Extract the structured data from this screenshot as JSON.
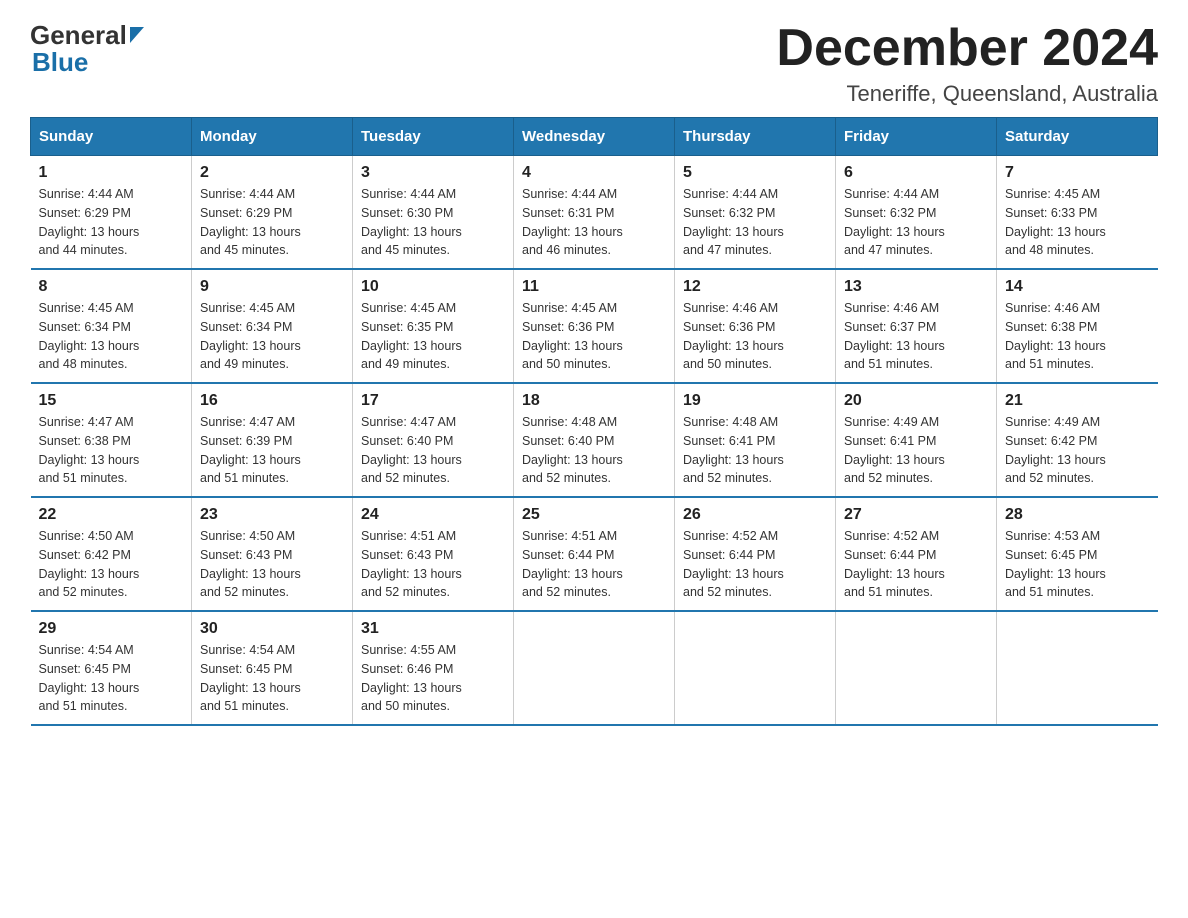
{
  "header": {
    "logo_general": "General",
    "logo_blue": "Blue",
    "month_title": "December 2024",
    "location": "Teneriffe, Queensland, Australia"
  },
  "weekdays": [
    "Sunday",
    "Monday",
    "Tuesday",
    "Wednesday",
    "Thursday",
    "Friday",
    "Saturday"
  ],
  "weeks": [
    [
      {
        "day": "1",
        "sunrise": "4:44 AM",
        "sunset": "6:29 PM",
        "daylight": "13 hours and 44 minutes."
      },
      {
        "day": "2",
        "sunrise": "4:44 AM",
        "sunset": "6:29 PM",
        "daylight": "13 hours and 45 minutes."
      },
      {
        "day": "3",
        "sunrise": "4:44 AM",
        "sunset": "6:30 PM",
        "daylight": "13 hours and 45 minutes."
      },
      {
        "day": "4",
        "sunrise": "4:44 AM",
        "sunset": "6:31 PM",
        "daylight": "13 hours and 46 minutes."
      },
      {
        "day": "5",
        "sunrise": "4:44 AM",
        "sunset": "6:32 PM",
        "daylight": "13 hours and 47 minutes."
      },
      {
        "day": "6",
        "sunrise": "4:44 AM",
        "sunset": "6:32 PM",
        "daylight": "13 hours and 47 minutes."
      },
      {
        "day": "7",
        "sunrise": "4:45 AM",
        "sunset": "6:33 PM",
        "daylight": "13 hours and 48 minutes."
      }
    ],
    [
      {
        "day": "8",
        "sunrise": "4:45 AM",
        "sunset": "6:34 PM",
        "daylight": "13 hours and 48 minutes."
      },
      {
        "day": "9",
        "sunrise": "4:45 AM",
        "sunset": "6:34 PM",
        "daylight": "13 hours and 49 minutes."
      },
      {
        "day": "10",
        "sunrise": "4:45 AM",
        "sunset": "6:35 PM",
        "daylight": "13 hours and 49 minutes."
      },
      {
        "day": "11",
        "sunrise": "4:45 AM",
        "sunset": "6:36 PM",
        "daylight": "13 hours and 50 minutes."
      },
      {
        "day": "12",
        "sunrise": "4:46 AM",
        "sunset": "6:36 PM",
        "daylight": "13 hours and 50 minutes."
      },
      {
        "day": "13",
        "sunrise": "4:46 AM",
        "sunset": "6:37 PM",
        "daylight": "13 hours and 51 minutes."
      },
      {
        "day": "14",
        "sunrise": "4:46 AM",
        "sunset": "6:38 PM",
        "daylight": "13 hours and 51 minutes."
      }
    ],
    [
      {
        "day": "15",
        "sunrise": "4:47 AM",
        "sunset": "6:38 PM",
        "daylight": "13 hours and 51 minutes."
      },
      {
        "day": "16",
        "sunrise": "4:47 AM",
        "sunset": "6:39 PM",
        "daylight": "13 hours and 51 minutes."
      },
      {
        "day": "17",
        "sunrise": "4:47 AM",
        "sunset": "6:40 PM",
        "daylight": "13 hours and 52 minutes."
      },
      {
        "day": "18",
        "sunrise": "4:48 AM",
        "sunset": "6:40 PM",
        "daylight": "13 hours and 52 minutes."
      },
      {
        "day": "19",
        "sunrise": "4:48 AM",
        "sunset": "6:41 PM",
        "daylight": "13 hours and 52 minutes."
      },
      {
        "day": "20",
        "sunrise": "4:49 AM",
        "sunset": "6:41 PM",
        "daylight": "13 hours and 52 minutes."
      },
      {
        "day": "21",
        "sunrise": "4:49 AM",
        "sunset": "6:42 PM",
        "daylight": "13 hours and 52 minutes."
      }
    ],
    [
      {
        "day": "22",
        "sunrise": "4:50 AM",
        "sunset": "6:42 PM",
        "daylight": "13 hours and 52 minutes."
      },
      {
        "day": "23",
        "sunrise": "4:50 AM",
        "sunset": "6:43 PM",
        "daylight": "13 hours and 52 minutes."
      },
      {
        "day": "24",
        "sunrise": "4:51 AM",
        "sunset": "6:43 PM",
        "daylight": "13 hours and 52 minutes."
      },
      {
        "day": "25",
        "sunrise": "4:51 AM",
        "sunset": "6:44 PM",
        "daylight": "13 hours and 52 minutes."
      },
      {
        "day": "26",
        "sunrise": "4:52 AM",
        "sunset": "6:44 PM",
        "daylight": "13 hours and 52 minutes."
      },
      {
        "day": "27",
        "sunrise": "4:52 AM",
        "sunset": "6:44 PM",
        "daylight": "13 hours and 51 minutes."
      },
      {
        "day": "28",
        "sunrise": "4:53 AM",
        "sunset": "6:45 PM",
        "daylight": "13 hours and 51 minutes."
      }
    ],
    [
      {
        "day": "29",
        "sunrise": "4:54 AM",
        "sunset": "6:45 PM",
        "daylight": "13 hours and 51 minutes."
      },
      {
        "day": "30",
        "sunrise": "4:54 AM",
        "sunset": "6:45 PM",
        "daylight": "13 hours and 51 minutes."
      },
      {
        "day": "31",
        "sunrise": "4:55 AM",
        "sunset": "6:46 PM",
        "daylight": "13 hours and 50 minutes."
      },
      null,
      null,
      null,
      null
    ]
  ],
  "labels": {
    "sunrise": "Sunrise:",
    "sunset": "Sunset:",
    "daylight": "Daylight:"
  }
}
